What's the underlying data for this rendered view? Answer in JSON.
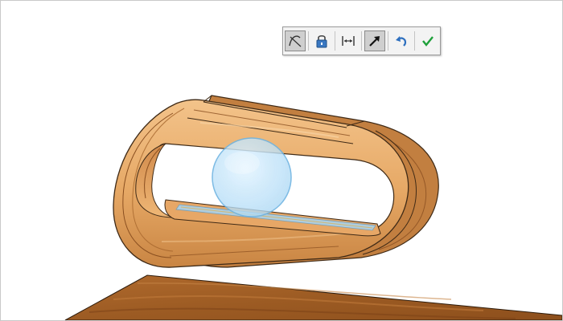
{
  "toolbar": {
    "buttons": [
      {
        "icon": "tangent-curve-icon",
        "active": true
      },
      {
        "icon": "lock-icon",
        "active": false
      },
      {
        "icon": "horizontal-dimension-icon",
        "active": false
      },
      {
        "icon": "move-arrow-icon",
        "active": true
      },
      {
        "icon": "undo-icon",
        "active": false
      },
      {
        "icon": "confirm-checkmark-icon",
        "active": false
      }
    ]
  },
  "colors": {
    "wood_light": "#efb978",
    "wood_mid": "#d99a58",
    "wood_dark": "#b9763c",
    "wood_edge": "#3f2a16",
    "table_wood": "#a8652a",
    "sphere_fill": "#bfe4fb",
    "sphere_edge": "#6fb4e2",
    "glass_strip": "#a9d2ec",
    "confirm_green": "#1ea03a",
    "undo_blue": "#2d6fbf"
  }
}
